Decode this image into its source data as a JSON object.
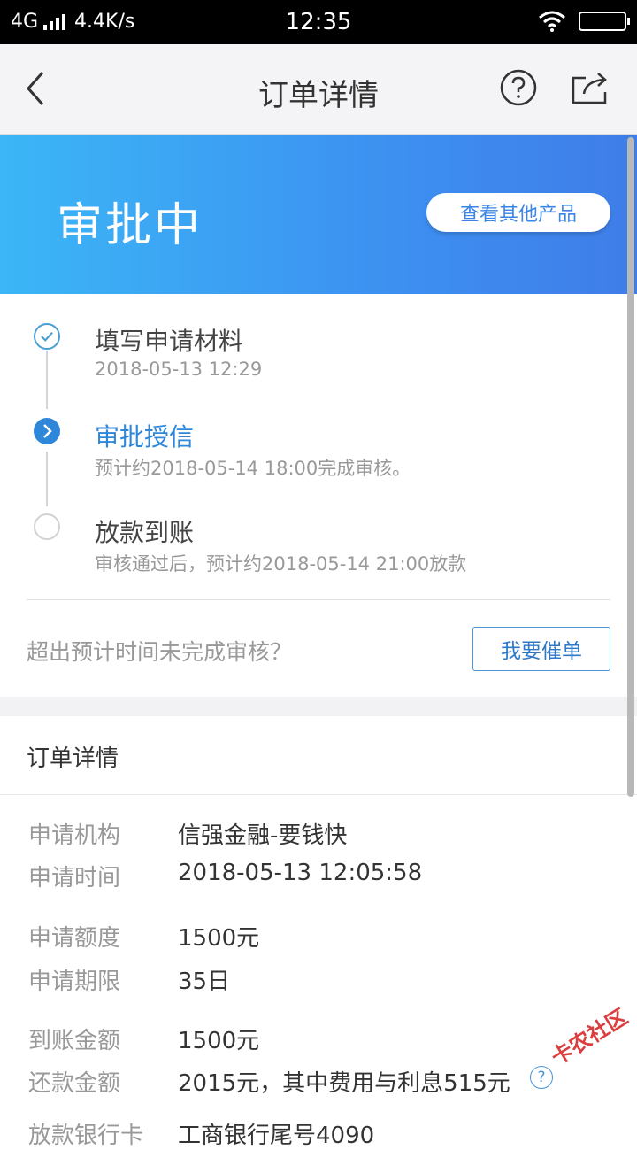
{
  "status_bar": {
    "network": "4G",
    "speed": "4.4K/s",
    "time": "12:35"
  },
  "nav": {
    "title": "订单详情",
    "icons": [
      "back-chevron-icon",
      "help-icon",
      "share-icon"
    ]
  },
  "banner": {
    "status": "审批中",
    "other_products_label": "查看其他产品",
    "gradient": [
      "#3bb6f6",
      "#3f7de8"
    ]
  },
  "steps": [
    {
      "title": "填写申请材料",
      "subtitle": "2018-05-13 12:29",
      "state": "done"
    },
    {
      "title": "审批授信",
      "subtitle": "预计约2018-05-14 18:00完成审核。",
      "state": "current"
    },
    {
      "title": "放款到账",
      "subtitle": "审核通过后，预计约2018-05-14 21:00放款",
      "state": "pending"
    }
  ],
  "overtime": {
    "question": "超出预计时间未完成审核？",
    "urge_label": "我要催单"
  },
  "details": {
    "title": "订单详情",
    "rows": [
      {
        "label": "申请机构",
        "value": "信强金融-要钱快"
      },
      {
        "label": "申请时间",
        "value": "2018-05-13 12:05:58"
      },
      {
        "label": "申请额度",
        "value": "1500元"
      },
      {
        "label": "申请期限",
        "value": "35日"
      },
      {
        "label": "到账金额",
        "value": "1500元"
      },
      {
        "label": "还款金额",
        "value": "2015元，其中费用与利息515元"
      },
      {
        "label": "放款银行卡",
        "value": "工商银行尾号4090"
      }
    ],
    "help_glyph": "?"
  },
  "watermark": "卡农社区",
  "colors": {
    "accent": "#2f87d9",
    "muted_text": "#999999"
  }
}
